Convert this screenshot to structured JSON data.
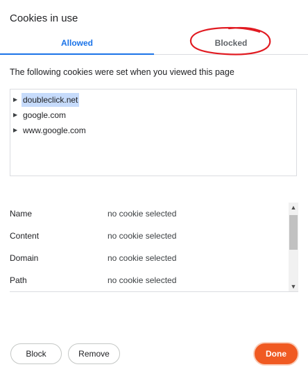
{
  "dialog": {
    "title": "Cookies in use"
  },
  "tabs": [
    {
      "label": "Allowed",
      "active": true
    },
    {
      "label": "Blocked",
      "active": false
    }
  ],
  "description": "The following cookies were set when you viewed this page",
  "cookie_tree": {
    "items": [
      {
        "label": "doubleclick.net",
        "selected": true
      },
      {
        "label": "google.com",
        "selected": false
      },
      {
        "label": "www.google.com",
        "selected": false
      }
    ]
  },
  "details": [
    {
      "key": "Name",
      "value": "no cookie selected"
    },
    {
      "key": "Content",
      "value": "no cookie selected"
    },
    {
      "key": "Domain",
      "value": "no cookie selected"
    },
    {
      "key": "Path",
      "value": "no cookie selected"
    }
  ],
  "buttons": {
    "block": "Block",
    "remove": "Remove",
    "done": "Done"
  },
  "colors": {
    "accent": "#1a73e8",
    "done_button": "#f05a22",
    "annotation": "#e11b22",
    "selection": "#c6dbfb"
  },
  "icons": {
    "tree_expand": "triangle-right-icon",
    "scroll_up": "chevron-up-icon",
    "scroll_down": "chevron-down-icon"
  }
}
